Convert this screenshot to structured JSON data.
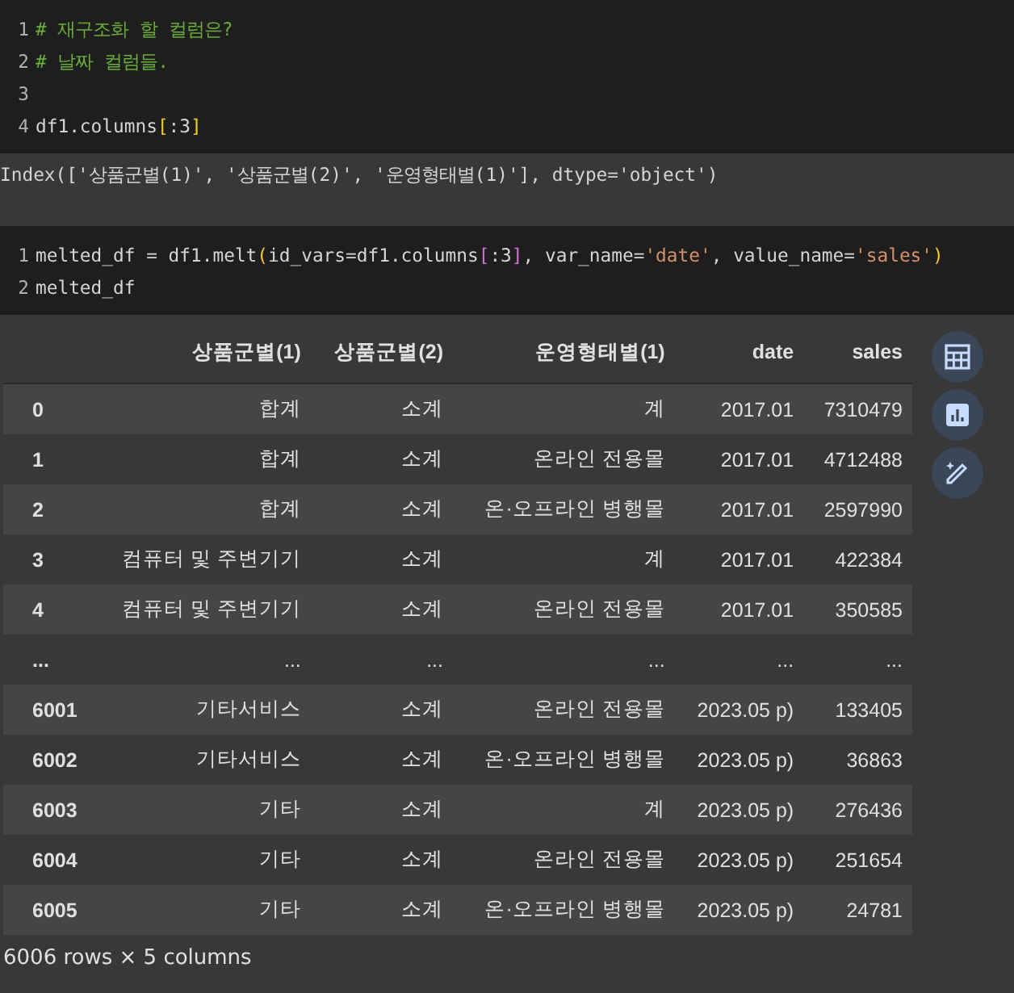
{
  "cells": [
    {
      "lines": [
        {
          "number": "1",
          "tokens": [
            {
              "kind": "comment",
              "text": "# 재구조화 할 컬럼은?"
            }
          ]
        },
        {
          "number": "2",
          "tokens": [
            {
              "kind": "comment",
              "text": "# 날짜 컬럼들."
            }
          ]
        },
        {
          "number": "3"
        },
        {
          "number": "4",
          "tokens": [
            {
              "kind": "plain",
              "text": "df1.columns"
            },
            {
              "kind": "bracket",
              "text": "["
            },
            {
              "kind": "plain",
              "text": ":3"
            },
            {
              "kind": "bracket",
              "text": "]"
            }
          ]
        }
      ],
      "output": "Index(['상품군별(1)', '상품군별(2)', '운영형태별(1)'], dtype='object')"
    },
    {
      "lines": [
        {
          "number": "1",
          "tokens": [
            {
              "kind": "plain",
              "text": "melted_df = df1.melt"
            },
            {
              "kind": "bracket",
              "text": "("
            },
            {
              "kind": "plain",
              "text": "id_vars=df1.columns"
            },
            {
              "kind": "bracket2",
              "text": "["
            },
            {
              "kind": "plain",
              "text": ":3"
            },
            {
              "kind": "bracket2",
              "text": "]"
            },
            {
              "kind": "plain",
              "text": ", var_name="
            },
            {
              "kind": "string",
              "text": "'date'"
            },
            {
              "kind": "plain",
              "text": ", value_name="
            },
            {
              "kind": "string",
              "text": "'sales'"
            },
            {
              "kind": "bracket",
              "text": ")"
            }
          ]
        },
        {
          "number": "2",
          "tokens": [
            {
              "kind": "plain",
              "text": "melted_df"
            }
          ]
        }
      ]
    }
  ],
  "table": {
    "columns": [
      "상품군별(1)",
      "상품군별(2)",
      "운영형태별(1)",
      "date",
      "sales"
    ],
    "rows": [
      {
        "index": "0",
        "cells": [
          "합계",
          "소계",
          "계",
          "2017.01",
          "7310479"
        ]
      },
      {
        "index": "1",
        "cells": [
          "합계",
          "소계",
          "온라인 전용몰",
          "2017.01",
          "4712488"
        ]
      },
      {
        "index": "2",
        "cells": [
          "합계",
          "소계",
          "온·오프라인 병행몰",
          "2017.01",
          "2597990"
        ]
      },
      {
        "index": "3",
        "cells": [
          "컴퓨터 및 주변기기",
          "소계",
          "계",
          "2017.01",
          "422384"
        ]
      },
      {
        "index": "4",
        "cells": [
          "컴퓨터 및 주변기기",
          "소계",
          "온라인 전용몰",
          "2017.01",
          "350585"
        ]
      },
      {
        "index": "...",
        "cells": [
          "...",
          "...",
          "...",
          "...",
          "..."
        ]
      },
      {
        "index": "6001",
        "cells": [
          "기타서비스",
          "소계",
          "온라인 전용몰",
          "2023.05 p)",
          "133405"
        ]
      },
      {
        "index": "6002",
        "cells": [
          "기타서비스",
          "소계",
          "온·오프라인 병행몰",
          "2023.05 p)",
          "36863"
        ]
      },
      {
        "index": "6003",
        "cells": [
          "기타",
          "소계",
          "계",
          "2023.05 p)",
          "276436"
        ]
      },
      {
        "index": "6004",
        "cells": [
          "기타",
          "소계",
          "온라인 전용몰",
          "2023.05 p)",
          "251654"
        ]
      },
      {
        "index": "6005",
        "cells": [
          "기타",
          "소계",
          "온·오프라인 병행몰",
          "2023.05 p)",
          "24781"
        ]
      }
    ],
    "summary": "6006 rows × 5 columns"
  }
}
